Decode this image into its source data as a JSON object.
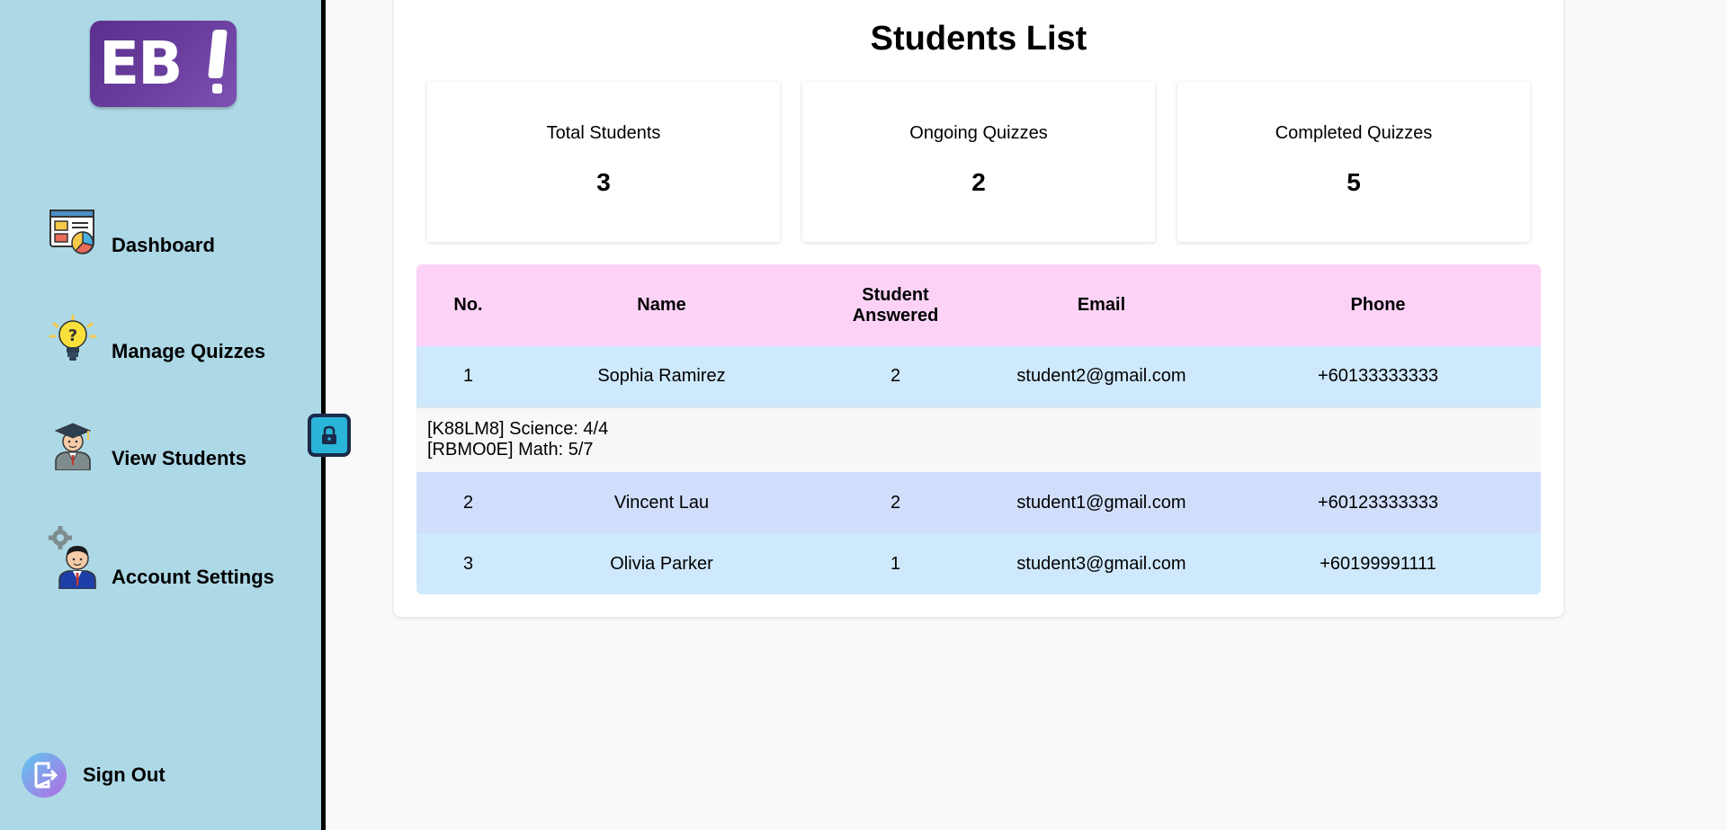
{
  "logo": {
    "text": "EB"
  },
  "sidebar": {
    "items": [
      {
        "label": "Dashboard",
        "icon": "dashboard-icon"
      },
      {
        "label": "Manage Quizzes",
        "icon": "lightbulb-question-icon"
      },
      {
        "label": "View Students",
        "icon": "graduate-student-icon"
      },
      {
        "label": "Account Settings",
        "icon": "user-settings-icon"
      }
    ],
    "sign_out": "Sign Out"
  },
  "lock_toggle": {
    "icon": "lock-icon"
  },
  "page": {
    "title": "Students List"
  },
  "stats": [
    {
      "label": "Total Students",
      "value": "3"
    },
    {
      "label": "Ongoing Quizzes",
      "value": "2"
    },
    {
      "label": "Completed Quizzes",
      "value": "5"
    }
  ],
  "table": {
    "headers": [
      "No.",
      "Name",
      "Student Answered",
      "Email",
      "Phone"
    ],
    "rows": [
      {
        "no": "1",
        "name": "Sophia Ramirez",
        "answered": "2",
        "email": "student2@gmail.com",
        "phone": "+60133333333"
      },
      {
        "no": "2",
        "name": "Vincent Lau",
        "answered": "2",
        "email": "student1@gmail.com",
        "phone": "+60123333333"
      },
      {
        "no": "3",
        "name": "Olivia Parker",
        "answered": "1",
        "email": "student3@gmail.com",
        "phone": "+60199991111"
      }
    ],
    "expanded_detail": [
      "[K88LM8] Science: 4/4",
      "[RBMO0E] Math: 5/7"
    ]
  },
  "colors": {
    "sidebar_bg": "#add8e6",
    "header_bg": "#fcd3f6",
    "row_bg": "#cfe9fc",
    "row_alt_bg": "#d0defc",
    "logo_purple": "#6b3fa0"
  }
}
